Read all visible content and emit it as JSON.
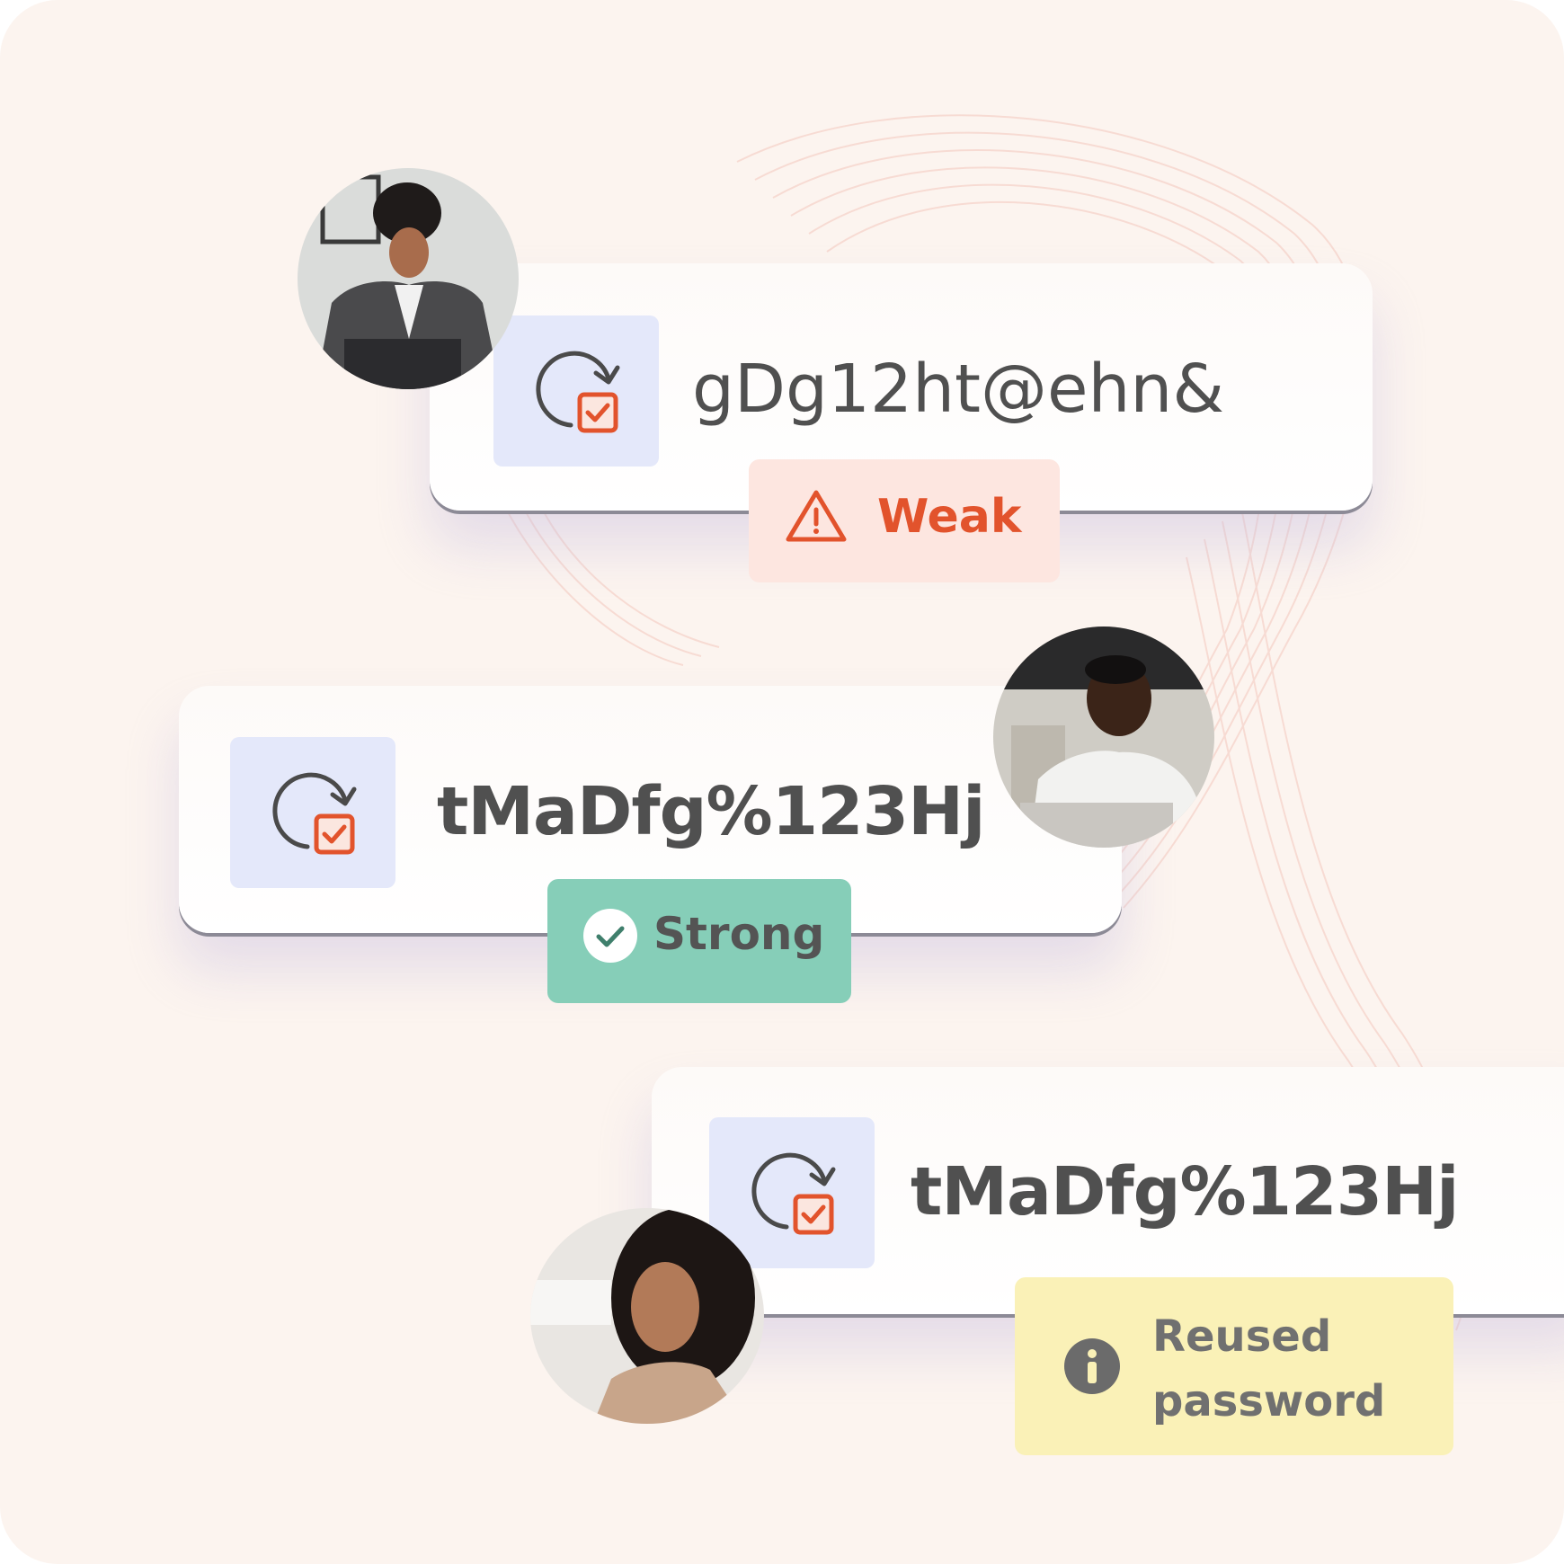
{
  "cards": [
    {
      "password": "gDg12ht@ehn&",
      "status": {
        "label": "Weak",
        "icon": "warning-triangle-icon",
        "color": "#e2532c",
        "background": "#fde6e0"
      },
      "avatar": "woman-with-laptop-avatar"
    },
    {
      "password": "tMaDfg%123Hj",
      "status": {
        "label": "Strong",
        "icon": "check-circle-icon",
        "color": "#545454",
        "background": "#86ceb8"
      },
      "avatar": "man-in-office-avatar"
    },
    {
      "password": "tMaDfg%123Hj",
      "status": {
        "label_line1": "Reused",
        "label_line2": "password",
        "icon": "info-circle-icon",
        "color": "#707070",
        "background": "#faf1b7"
      },
      "avatar": "smiling-woman-avatar"
    }
  ],
  "password_icon": "password-rotate-check-icon",
  "colors": {
    "background": "#fcf4ef",
    "icon_tile": "#e4e8fa",
    "accent": "#e2532c",
    "password_text": "#505050"
  }
}
